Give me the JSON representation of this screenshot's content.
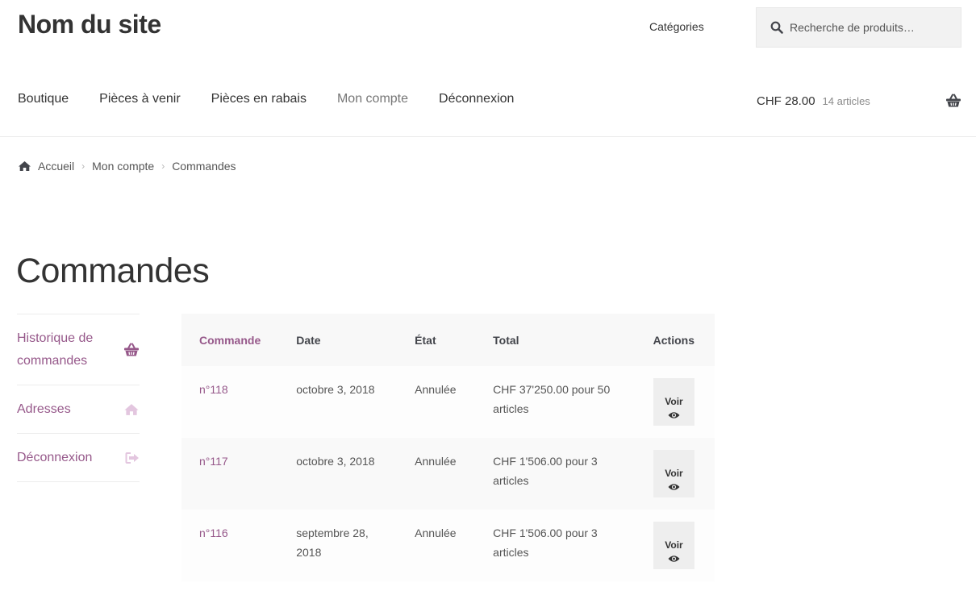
{
  "header": {
    "site_title": "Nom du site",
    "categories_link": "Catégories",
    "search": {
      "placeholder": "Recherche de produits…"
    },
    "icons": {
      "search": "search-icon",
      "cart": "basket-icon"
    }
  },
  "nav": {
    "items": [
      {
        "label": "Boutique",
        "active": false
      },
      {
        "label": "Pièces à venir",
        "active": false
      },
      {
        "label": "Pièces en rabais",
        "active": false
      },
      {
        "label": "Mon compte",
        "active": true
      },
      {
        "label": "Déconnexion",
        "active": false
      }
    ]
  },
  "cart": {
    "amount": "CHF 28.00",
    "count": "14 articles"
  },
  "breadcrumb": {
    "home": "Accueil",
    "parent": "Mon compte",
    "current": "Commandes"
  },
  "page": {
    "title": "Commandes"
  },
  "account_nav": {
    "items": [
      {
        "label": "Historique de commandes",
        "icon": "basket-icon"
      },
      {
        "label": "Adresses",
        "icon": "home-icon"
      },
      {
        "label": "Déconnexion",
        "icon": "sign-out-icon"
      }
    ]
  },
  "orders": {
    "headers": {
      "order": "Commande",
      "date": "Date",
      "status": "État",
      "total": "Total",
      "actions": "Actions"
    },
    "rows": [
      {
        "order": "n°118",
        "date": "octobre 3, 2018",
        "status": "Annulée",
        "total": "CHF 37'250.00 pour 50 articles",
        "action": "Voir"
      },
      {
        "order": "n°117",
        "date": "octobre 3, 2018",
        "status": "Annulée",
        "total": "CHF 1'506.00 pour 3 articles",
        "action": "Voir"
      },
      {
        "order": "n°116",
        "date": "septembre 28, 2018",
        "status": "Annulée",
        "total": "CHF 1'506.00 pour 3 articles",
        "action": "Voir"
      }
    ]
  },
  "colors": {
    "accent": "#96588a",
    "text": "#43454b",
    "table_header_bg": "#f8f8f8",
    "button_bg": "#eeeeee"
  }
}
